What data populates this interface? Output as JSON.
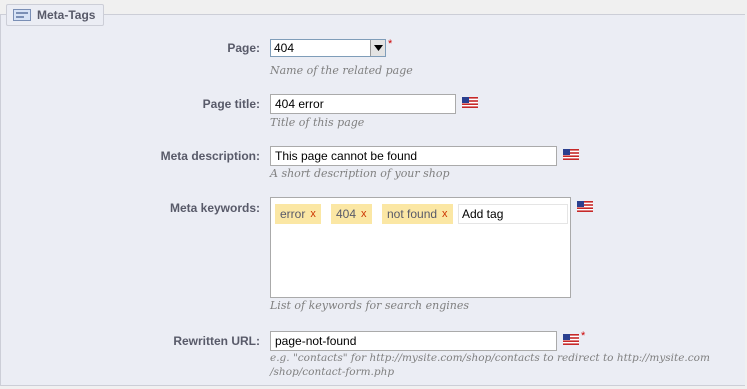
{
  "legend": {
    "title": "Meta-Tags",
    "icon": "tag-icon"
  },
  "page": {
    "label": "Page:",
    "value": "404",
    "required": "*",
    "hint": "Name of the related page"
  },
  "page_title": {
    "label": "Page title:",
    "value": "404 error",
    "hint": "Title of this page"
  },
  "meta_description": {
    "label": "Meta description:",
    "value": "This page cannot be found",
    "hint": "A short description of your shop"
  },
  "meta_keywords": {
    "label": "Meta keywords:",
    "tags": [
      {
        "text": "error",
        "remove": "x"
      },
      {
        "text": "404",
        "remove": "x"
      },
      {
        "text": "not found",
        "remove": "x"
      }
    ],
    "add_placeholder": "Add tag",
    "hint": "List of keywords for search engines"
  },
  "rewritten_url": {
    "label": "Rewritten URL:",
    "value": "page-not-found",
    "required": "*",
    "hint_line1": "e.g. \"contacts\" for http://mysite.com/shop/contacts to redirect to http://mysite.com",
    "hint_line2": "/shop/contact-form.php"
  },
  "colors": {
    "background": "#ebedf4",
    "label": "#585a69",
    "hint": "#7f7f7f",
    "tag": "#fbe7a4",
    "tag_remove": "#cc3300",
    "required": "#cc0000"
  }
}
